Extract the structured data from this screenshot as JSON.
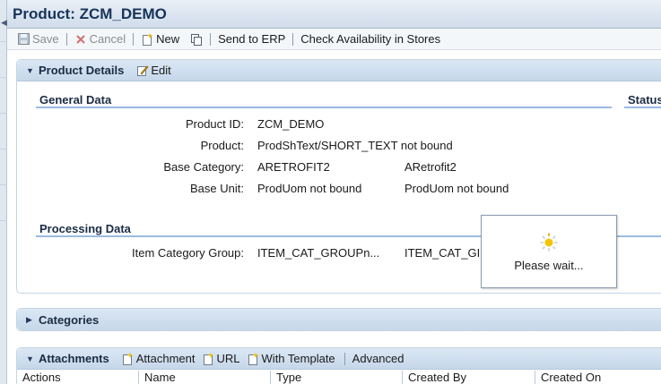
{
  "window": {
    "title": "Product: ZCM_DEMO"
  },
  "toolbar": {
    "save": "Save",
    "cancel": "Cancel",
    "new": "New",
    "send_to_erp": "Send to ERP",
    "check_availability": "Check Availability in Stores"
  },
  "product_details": {
    "title": "Product Details",
    "edit": "Edit",
    "general_data_title": "General Data",
    "status_title": "Status",
    "fields": {
      "product_id_label": "Product ID:",
      "product_id_value": "ZCM_DEMO",
      "product_label": "Product:",
      "product_value": "ProdShText/SHORT_TEXT not bound",
      "base_category_label": "Base Category:",
      "base_category_value": "ARETROFIT2",
      "base_category_desc": "ARetrofit2",
      "base_unit_label": "Base Unit:",
      "base_unit_value": "ProdUom not bound",
      "base_unit_desc": "ProdUom not bound"
    },
    "processing_data_title": "Processing Data",
    "item_category_group_label": "Item Category Group:",
    "item_category_group_value": "ITEM_CAT_GROUPn...",
    "item_category_group_desc": "ITEM_CAT_GI"
  },
  "wait_dialog": {
    "text": "Please wait..."
  },
  "categories": {
    "title": "Categories"
  },
  "attachments": {
    "title": "Attachments",
    "attachment": "Attachment",
    "url": "URL",
    "with_template": "With Template",
    "advanced": "Advanced",
    "columns": [
      "Actions",
      "Name",
      "Type",
      "Created By",
      "Created On"
    ]
  },
  "colors": {
    "accent": "#19335a",
    "header_bg": "#c6d7ea",
    "section_line": "#9bbbe0"
  }
}
